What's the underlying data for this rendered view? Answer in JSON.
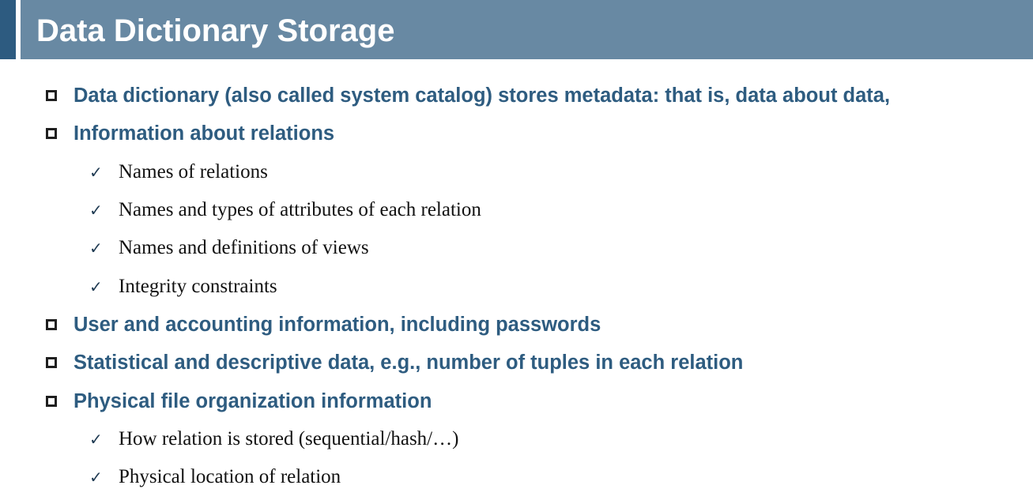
{
  "slide": {
    "title": "Data Dictionary Storage",
    "items": [
      {
        "level": 1,
        "icon": "square-bullet-icon",
        "text": "Data dictionary (also called system catalog) stores metadata:  that is, data about data,"
      },
      {
        "level": 1,
        "icon": "square-bullet-icon",
        "text": "Information about relations"
      },
      {
        "level": 2,
        "icon": "checkmark-icon",
        "text": "Names of relations"
      },
      {
        "level": 2,
        "icon": "checkmark-icon",
        "text": "Names and types of attributes of each relation"
      },
      {
        "level": 2,
        "icon": "checkmark-icon",
        "text": "Names and definitions of views"
      },
      {
        "level": 2,
        "icon": "checkmark-icon",
        "text": "Integrity constraints"
      },
      {
        "level": 1,
        "icon": "square-bullet-icon",
        "text": "User and accounting information, including passwords"
      },
      {
        "level": 1,
        "icon": "square-bullet-icon",
        "text": "Statistical and descriptive data, e.g., number of tuples in each relation"
      },
      {
        "level": 1,
        "icon": "square-bullet-icon",
        "text": "Physical file organization information"
      },
      {
        "level": 2,
        "icon": "checkmark-icon",
        "text": "How relation is stored (sequential/hash/…)"
      },
      {
        "level": 2,
        "icon": "checkmark-icon",
        "text": "Physical location of relation"
      }
    ]
  },
  "colors": {
    "title_bar": "#6889a3",
    "title_accent": "#2d5b80",
    "level1_text": "#2e5c80",
    "level2_text": "#111111"
  }
}
